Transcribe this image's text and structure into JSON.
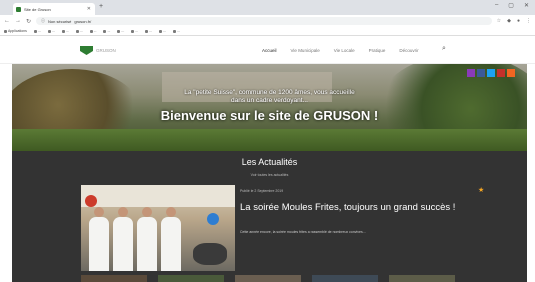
{
  "browser": {
    "tab_title": "Site de Gruson",
    "address": "gruson.fr/",
    "address_secure": "Non sécurisé",
    "bookmarks": [
      "Applications",
      "...",
      "...",
      "...",
      "...",
      "...",
      "...",
      "...",
      "...",
      "...",
      "...",
      "..."
    ]
  },
  "site": {
    "name": "GRUSON",
    "nav": [
      {
        "label": "Accueil",
        "active": true
      },
      {
        "label": "Vie Municipale",
        "active": false
      },
      {
        "label": "Vie Locale",
        "active": false
      },
      {
        "label": "Pratique",
        "active": false
      },
      {
        "label": "Découvrir",
        "active": false
      }
    ]
  },
  "hero": {
    "tagline_line1": "La \"petite Suisse\", commune de 1200 âmes, vous accueille",
    "tagline_line2": "dans un cadre verdoyant...",
    "title": "Bienvenue sur le site de GRUSON !",
    "social": [
      {
        "icon": "instagram-icon",
        "color": "#8a3ab9"
      },
      {
        "icon": "facebook-icon",
        "color": "#3b5998"
      },
      {
        "icon": "twitter-icon",
        "color": "#1da1f2"
      },
      {
        "icon": "youtube-icon",
        "color": "#c4302b"
      },
      {
        "icon": "rss-icon",
        "color": "#f26522"
      }
    ]
  },
  "news": {
    "heading": "Les Actualités",
    "subheading": "Voir toutes les actualités",
    "article": {
      "meta": "Publié le 2 Septembre 2019",
      "title": "La soirée Moules Frites, toujours un grand succès !",
      "excerpt": "Cette année encore, la soirée moules frites a rassemblé de nombreux convives..."
    }
  },
  "colors": {
    "brand_green": "#2e7d32",
    "news_bg": "#333333",
    "accent_star": "#f5a623"
  }
}
